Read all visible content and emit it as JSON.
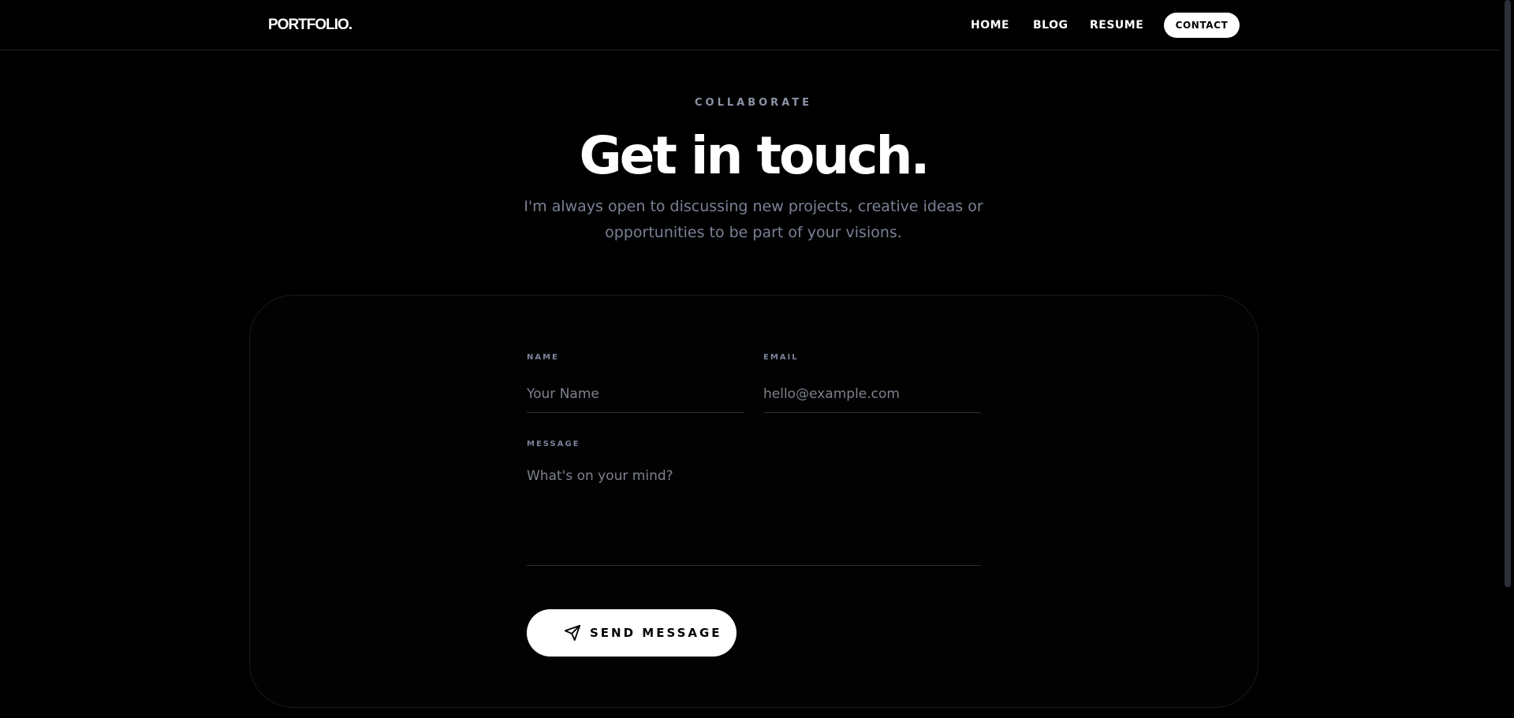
{
  "header": {
    "logo": "PORTFOLIO.",
    "nav": {
      "home": "HOME",
      "blog": "BLOG",
      "resume": "RESUME",
      "contact": "CONTACT"
    }
  },
  "hero": {
    "eyebrow": "COLLABORATE",
    "title": "Get in touch.",
    "subtitle": "I'm always open to discussing new projects, creative ideas or opportunities to be part of your visions."
  },
  "form": {
    "name": {
      "label": "NAME",
      "placeholder": "Your Name",
      "value": ""
    },
    "email": {
      "label": "EMAIL",
      "placeholder": "hello@example.com",
      "value": ""
    },
    "message": {
      "label": "MESSAGE",
      "placeholder": "What's on your mind?",
      "value": ""
    },
    "submit_label": "SEND MESSAGE",
    "submit_icon": "paper-plane-icon"
  },
  "colors": {
    "background": "#000000",
    "text": "#ffffff",
    "muted": "#7b8296",
    "button_bg": "#ffffff",
    "button_text": "#000000",
    "border": "#161922"
  }
}
